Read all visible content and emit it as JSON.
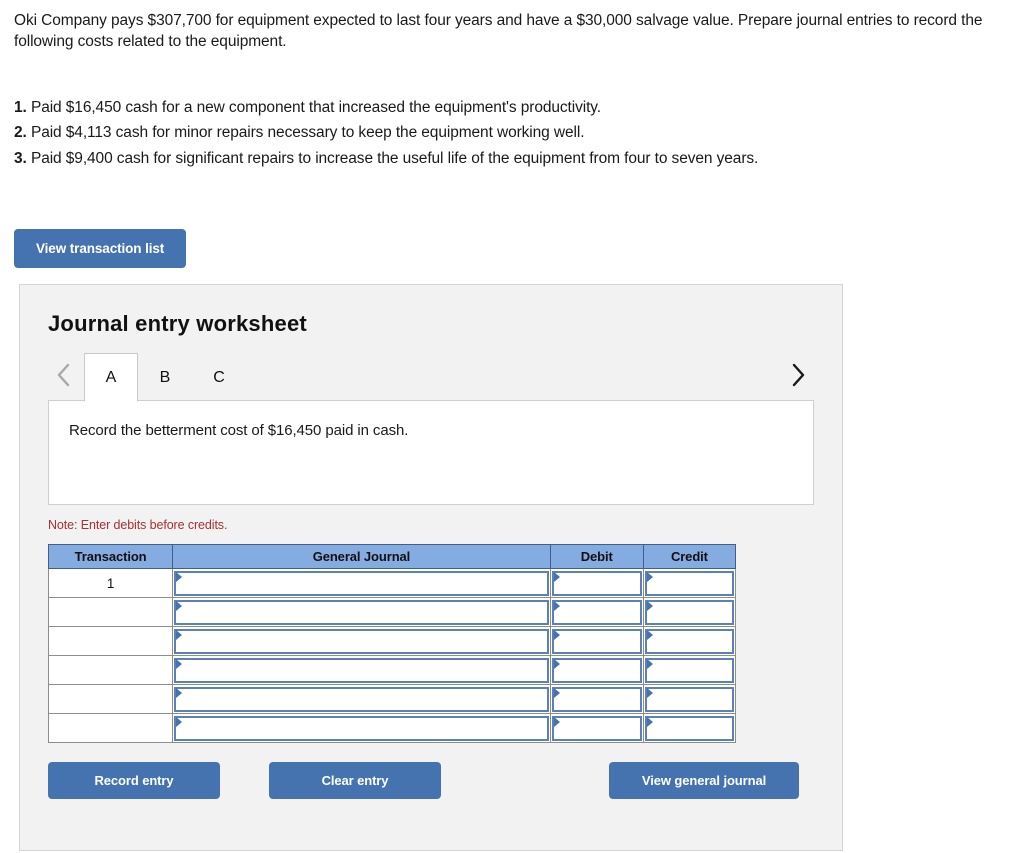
{
  "problem": {
    "paragraph": "Oki Company pays $307,700 for equipment expected to last four years and have a $30,000 salvage value. Prepare journal entries to record the following costs related to the equipment.",
    "items": [
      {
        "num": "1.",
        "text": "Paid $16,450 cash for a new component that increased the equipment's productivity."
      },
      {
        "num": "2.",
        "text": "Paid $4,113 cash for minor repairs necessary to keep the equipment working well."
      },
      {
        "num": "3.",
        "text": "Paid $9,400 cash for significant repairs to increase the useful life of the equipment from four to seven years."
      }
    ]
  },
  "top_button": {
    "label": "View transaction list"
  },
  "worksheet": {
    "title": "Journal entry worksheet",
    "tabs": [
      {
        "label": "A",
        "active": true
      },
      {
        "label": "B",
        "active": false
      },
      {
        "label": "C",
        "active": false
      }
    ],
    "prev_icon": "chevron-left-icon",
    "next_icon": "chevron-right-icon",
    "requirement_text": "Record the betterment cost of $16,450 paid in cash.",
    "note": "Note: Enter debits before credits.",
    "table": {
      "headers": [
        "Transaction",
        "General Journal",
        "Debit",
        "Credit"
      ],
      "rows": [
        {
          "transaction": "1",
          "general_journal": "",
          "debit": "",
          "credit": ""
        },
        {
          "transaction": "",
          "general_journal": "",
          "debit": "",
          "credit": ""
        },
        {
          "transaction": "",
          "general_journal": "",
          "debit": "",
          "credit": ""
        },
        {
          "transaction": "",
          "general_journal": "",
          "debit": "",
          "credit": ""
        },
        {
          "transaction": "",
          "general_journal": "",
          "debit": "",
          "credit": ""
        },
        {
          "transaction": "",
          "general_journal": "",
          "debit": "",
          "credit": ""
        }
      ]
    },
    "actions": {
      "record": "Record entry",
      "clear": "Clear entry",
      "view_journal": "View general journal"
    }
  },
  "colors": {
    "button_blue": "#4573b0",
    "table_header_blue": "#85ace0",
    "input_border_blue": "#5a82b8",
    "note_red": "#ab3030",
    "panel_gray": "#f2f2f2"
  }
}
